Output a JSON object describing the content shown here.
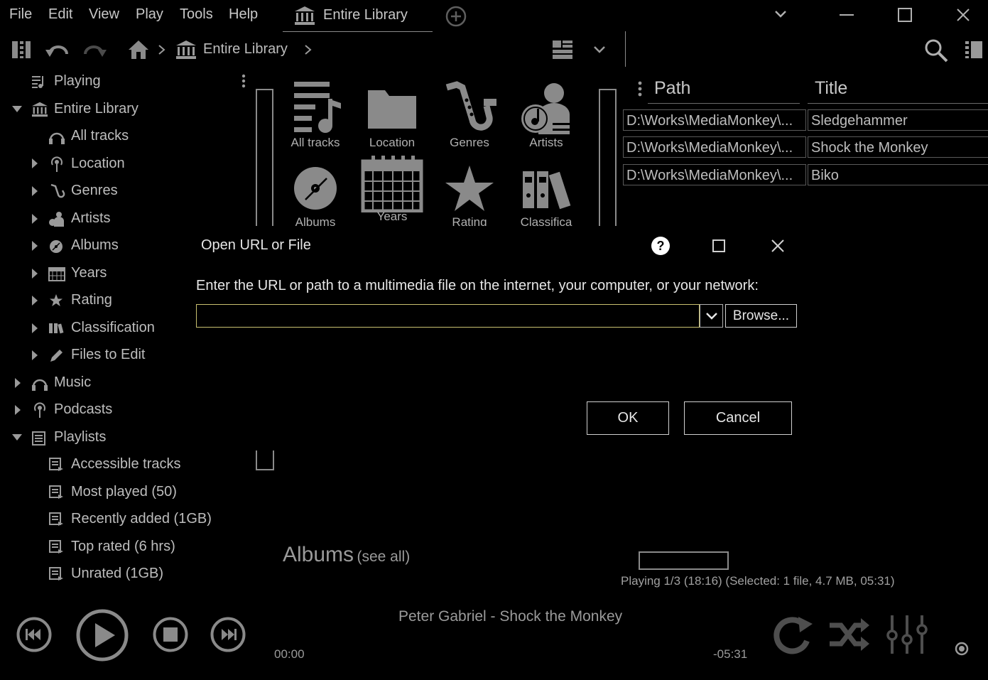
{
  "menubar": {
    "items": [
      "File",
      "Edit",
      "View",
      "Play",
      "Tools",
      "Help"
    ],
    "tab_label": "Entire Library"
  },
  "toolbar": {
    "breadcrumb_label": "Entire Library"
  },
  "tree": {
    "playing": "Playing",
    "entire_library": "Entire Library",
    "all_tracks": "All tracks",
    "location": "Location",
    "genres": "Genres",
    "artists": "Artists",
    "albums": "Albums",
    "years": "Years",
    "rating": "Rating",
    "classification": "Classification",
    "files_to_edit": "Files to Edit",
    "music": "Music",
    "podcasts": "Podcasts",
    "playlists": "Playlists",
    "playlist_items": [
      "Accessible tracks",
      "Most played (50)",
      "Recently added (1GB)",
      "Top rated (6 hrs)",
      "Unrated (1GB)"
    ]
  },
  "tiles": {
    "all_tracks": "All tracks",
    "location": "Location",
    "genres": "Genres",
    "artists": "Artists",
    "albums": "Albums",
    "years": "Years",
    "rating": "Rating",
    "classification": "Classifica"
  },
  "tracklist": {
    "columns": [
      "Path",
      "Title"
    ],
    "rows": [
      {
        "path": "D:\\Works\\MediaMonkey\\...",
        "title": "Sledgehammer"
      },
      {
        "path": "D:\\Works\\MediaMonkey\\...",
        "title": "Shock the Monkey"
      },
      {
        "path": "D:\\Works\\MediaMonkey\\...",
        "title": "Biko"
      }
    ]
  },
  "albums_section": {
    "title": "Albums",
    "see_all": "(see all)"
  },
  "status": "Playing 1/3 (18:16) (Selected: 1 file, 4.7 MB, 05:31)",
  "player": {
    "now_playing": "Peter Gabriel - Shock the Monkey",
    "elapsed": "00:00",
    "remaining": "-05:31"
  },
  "dialog": {
    "title": "Open URL or File",
    "prompt": "Enter the URL or path to a multimedia file on the internet, your computer, or your network:",
    "input_value": "",
    "browse_label": "Browse...",
    "ok_label": "OK",
    "cancel_label": "Cancel"
  },
  "colors": {
    "background": "#000000",
    "text": "#bdbdbd",
    "icon": "#8a8a8a",
    "input_border": "#c8c070"
  }
}
